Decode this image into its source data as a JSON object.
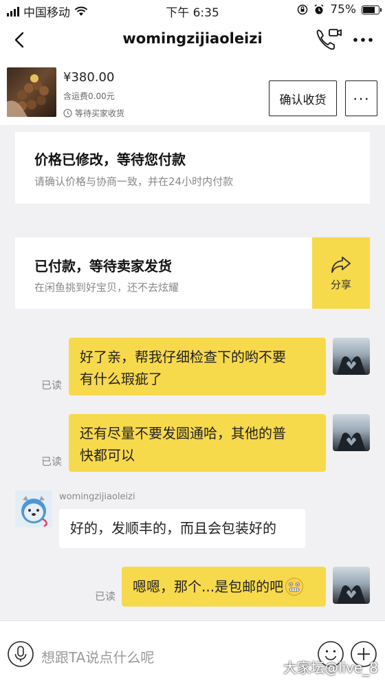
{
  "status_bar": {
    "carrier": "中国移动",
    "time": "下午 6:35",
    "battery": "75%",
    "battery_level": 0.75
  },
  "nav": {
    "title": "womingzijiaoleizi"
  },
  "order": {
    "price": "¥380.00",
    "shipping": "含运费0.00元",
    "status": "等待买家收货",
    "confirm_label": "确认收货",
    "more_label": "···"
  },
  "cards": [
    {
      "title": "价格已修改，等待您付款",
      "subtitle": "请确认价格与协商一致，并在24小时内付款"
    },
    {
      "title": "已付款，等待卖家发货",
      "subtitle": "在闲鱼挑到好宝贝，还不去炫耀",
      "action_label": "分享"
    }
  ],
  "messages": [
    {
      "from": "me",
      "lines": [
        "好了亲，帮我仔细检查下的哟不要",
        "有什么瑕疵了"
      ],
      "read_label": "已读"
    },
    {
      "from": "me",
      "lines": [
        "还有尽量不要发圆通哈，其他的普",
        "快都可以"
      ],
      "read_label": "已读"
    },
    {
      "from": "them",
      "sender": "womingzijiaoleizi",
      "lines": [
        "好的，发顺丰的，而且会包装好的"
      ]
    },
    {
      "from": "me",
      "lines": [
        "嗯嗯，那个...是包邮的吧"
      ],
      "read_label": "已读"
    }
  ],
  "input": {
    "placeholder": "想跟TA说点什么呢"
  },
  "watermark": "大家坛@live_8",
  "colors": {
    "accent": "#f7d94c",
    "background": "#f1f1f3"
  }
}
